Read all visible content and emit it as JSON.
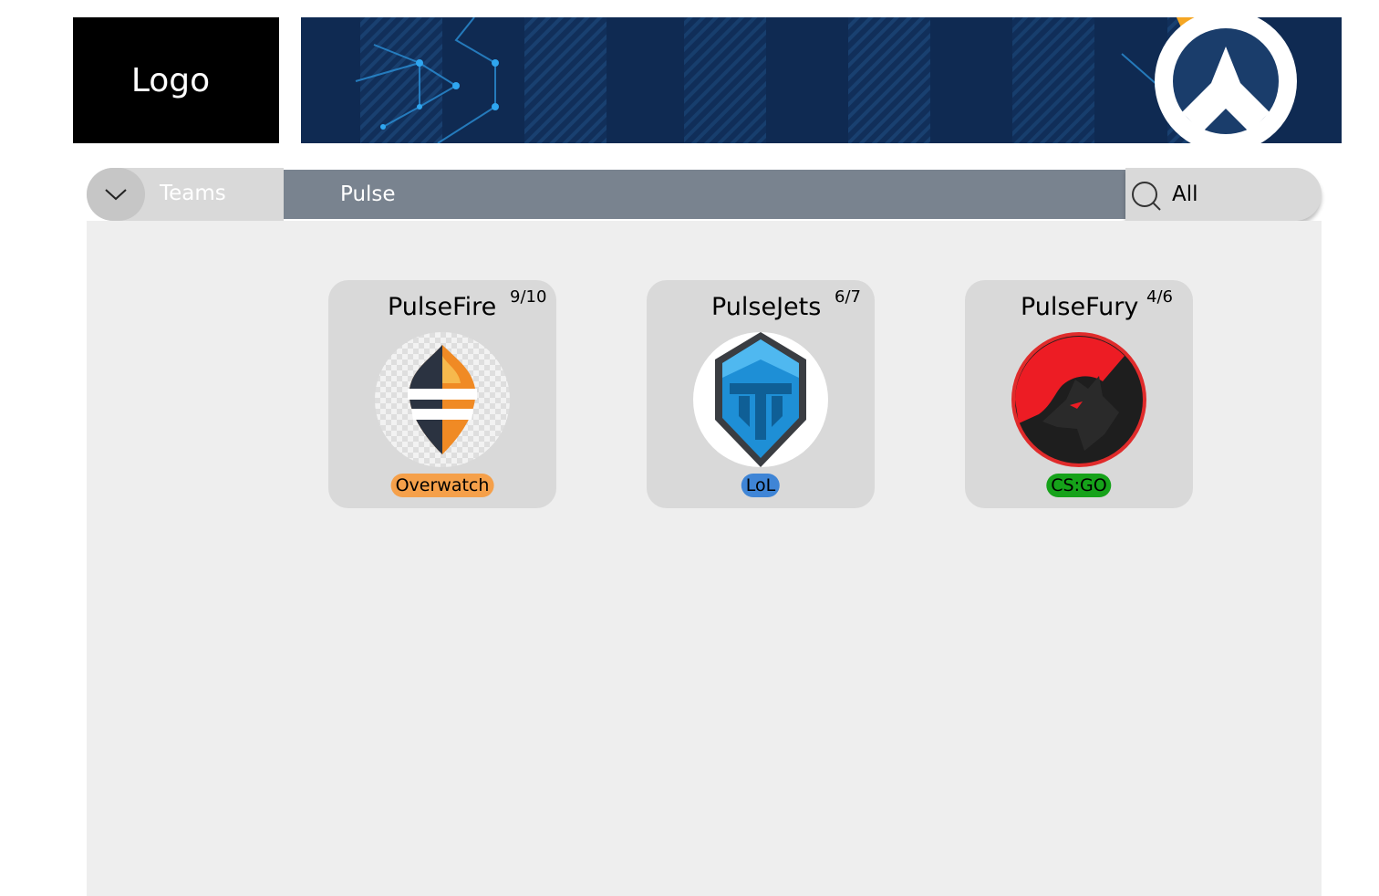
{
  "header": {
    "logo_text": "Logo"
  },
  "filter": {
    "category_label": "Teams",
    "search_value": "Pulse",
    "scope_value": "All"
  },
  "teams": [
    {
      "name": "PulseFire",
      "count": "9/10",
      "game": "Overwatch",
      "game_color": "#f5a04a"
    },
    {
      "name": "PulseJets",
      "count": "6/7",
      "game": "LoL",
      "game_color": "#3f85d6"
    },
    {
      "name": "PulseFury",
      "count": "4/6",
      "game": "CS:GO",
      "game_color": "#16a21a"
    }
  ]
}
